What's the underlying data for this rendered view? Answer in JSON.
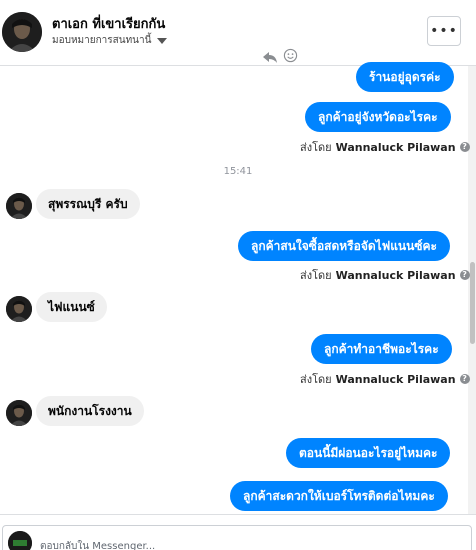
{
  "header": {
    "title": "ตาเอก ที่เขาเรียกกัน",
    "assign_label": "มอบหมายการสนทนานี้",
    "more_label": "•••"
  },
  "conversation": {
    "messages": [
      {
        "direction": "out",
        "text": "ร้านอยู่อุดรค่ะ"
      },
      {
        "direction": "out",
        "text": "ลูกค้าอยู่จังหวัดอะไรคะ"
      },
      {
        "sent_by_prefix": "ส่งโดย",
        "sent_by_name": "Wannaluck Pilawan"
      },
      {
        "timestamp": "15:41"
      },
      {
        "direction": "in",
        "text": "สุพรรณบุรี ครับ"
      },
      {
        "direction": "out",
        "text": "ลูกค้าสนใจซื้อสดหรือจัดไฟแนนซ์คะ"
      },
      {
        "sent_by_prefix": "ส่งโดย",
        "sent_by_name": "Wannaluck Pilawan"
      },
      {
        "direction": "in",
        "text": "ไฟแนนซ์"
      },
      {
        "direction": "out",
        "text": "ลูกค้าทำอาชีพอะไรคะ"
      },
      {
        "sent_by_prefix": "ส่งโดย",
        "sent_by_name": "Wannaluck Pilawan"
      },
      {
        "direction": "in",
        "text": "พนักงานโรงงาน"
      },
      {
        "direction": "out",
        "text": "ตอนนี้มีผ่อนอะไรอยู่ไหมคะ"
      },
      {
        "direction": "out",
        "text": "ลูกค้าสะดวกให้เบอร์โทรติดต่อไหมคะ"
      }
    ]
  },
  "icons": {
    "reply": "reply-icon",
    "react": "smiley-icon",
    "info": "info-icon",
    "caret": "caret-down-icon"
  },
  "composer": {
    "placeholder": "ตอบกลับใน Messenger..."
  },
  "colors": {
    "outgoing_bubble": "#0084ff",
    "incoming_bubble": "#f0f0f0",
    "text_primary": "#050505",
    "timestamp": "#90949c"
  }
}
